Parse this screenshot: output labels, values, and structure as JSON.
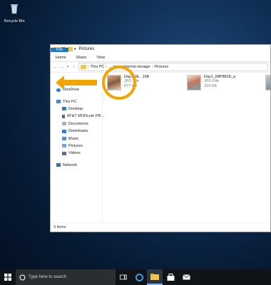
{
  "desktop": {
    "recycle_bin_label": "Recycle Bin"
  },
  "window": {
    "title": "Pictures",
    "ribbon_tabs": [
      "File",
      "Home",
      "Share",
      "View"
    ],
    "address": [
      "This PC",
      "...",
      "me",
      "Internal storage",
      "Pictures"
    ],
    "status": "3 items"
  },
  "nav": {
    "onedrive": "OneDrive",
    "this_pc": "This PC",
    "desktop": "Desktop",
    "att": "AT&T MODcute PR...",
    "documents": "Documents",
    "downloads": "Downloads",
    "music": "Music",
    "pictures": "Pictures",
    "videos": "Videos",
    "network": "Network"
  },
  "files": [
    {
      "name": "Day1_IE...168",
      "type": "JPG File",
      "size": "677 KB"
    },
    {
      "name": "Day1_IMP8818_a",
      "type": "JPG File",
      "size": "324 KB"
    }
  ],
  "taskbar": {
    "search_placeholder": "Type here to search"
  },
  "colors": {
    "highlight": "#f0a500",
    "file_tab": "#1979ca"
  }
}
